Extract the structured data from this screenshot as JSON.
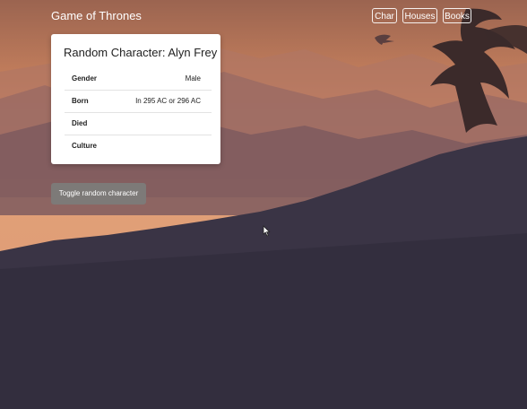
{
  "app": {
    "title": "Game of Thrones"
  },
  "nav": {
    "items": [
      "Char",
      "Houses",
      "Books"
    ]
  },
  "card": {
    "title": "Random Character: Alyn Frey",
    "rows": [
      {
        "label": "Gender",
        "value": "Male"
      },
      {
        "label": "Born",
        "value": "In 295 AC or 296 AC"
      },
      {
        "label": "Died",
        "value": ""
      },
      {
        "label": "Culture",
        "value": ""
      }
    ]
  },
  "toggle_button": {
    "label": "Toggle random character"
  },
  "colors": {
    "sky_top": "#a86a4d",
    "sky_mid": "#e09a6a",
    "ground": "#2c2a39",
    "button": "#7d7a78"
  },
  "icons": {
    "cursor": "mouse-pointer-icon",
    "dragon": "dragon-silhouette",
    "bird": "small-dragon-silhouette"
  }
}
